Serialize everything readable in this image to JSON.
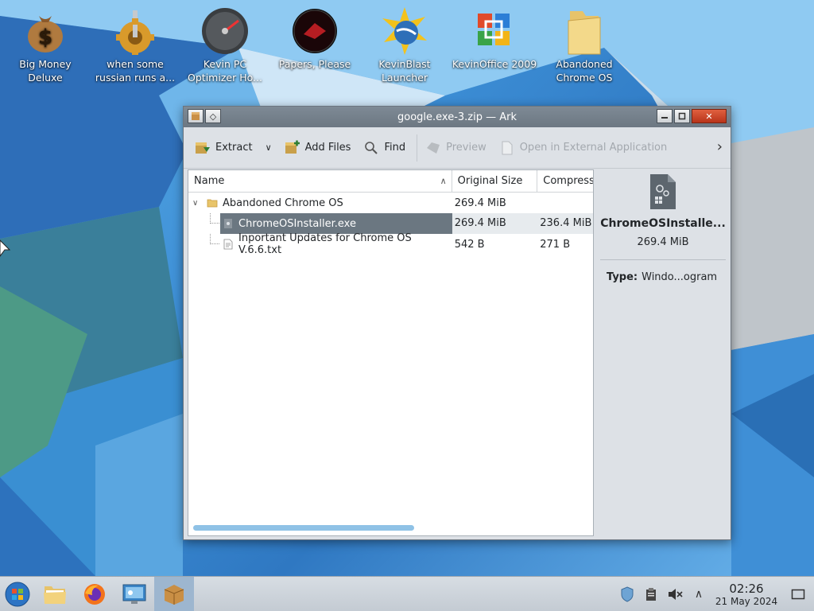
{
  "desktop": {
    "icons": [
      {
        "label": "Big Money Deluxe",
        "icon": "money-bag-icon"
      },
      {
        "label": "when some russian runs a...",
        "icon": "gear-icon"
      },
      {
        "label": "Kevin PC Optimizer Ho...",
        "icon": "gauge-icon"
      },
      {
        "label": "Papers, Please",
        "icon": "papers-please-icon"
      },
      {
        "label": "KevinBlast Launcher",
        "icon": "globe-icon"
      },
      {
        "label": "KevinOffice 2009",
        "icon": "office-icon"
      },
      {
        "label": "Abandoned Chrome OS",
        "icon": "folder-icon"
      }
    ]
  },
  "window": {
    "title": "google.exe-3.zip — Ark",
    "controls": {
      "minimize": "minimize-icon",
      "maximize": "maximize-icon",
      "close": "close-icon"
    }
  },
  "toolbar": {
    "extract": "Extract",
    "add_files": "Add Files",
    "find": "Find",
    "preview": "Preview",
    "open_external": "Open in External Application"
  },
  "filelist": {
    "columns": [
      "Name",
      "Original Size",
      "Compress"
    ],
    "rows": [
      {
        "name": "Abandoned Chrome OS",
        "size": "269.4 MiB",
        "compressed": "",
        "type": "folder"
      },
      {
        "name": "ChromeOSInstaller.exe",
        "size": "269.4 MiB",
        "compressed": "236.4 MiB",
        "type": "exe"
      },
      {
        "name": "Inportant Updates for Chrome OS V.6.6.txt",
        "size": "542 B",
        "compressed": "271 B",
        "type": "txt"
      }
    ]
  },
  "details": {
    "name": "ChromeOSInstalle...",
    "size": "269.4 MiB",
    "type_label": "Type:",
    "type_value": "Windo...ogram"
  },
  "taskbar": {
    "time": "02:26",
    "date": "21 May 2024"
  }
}
